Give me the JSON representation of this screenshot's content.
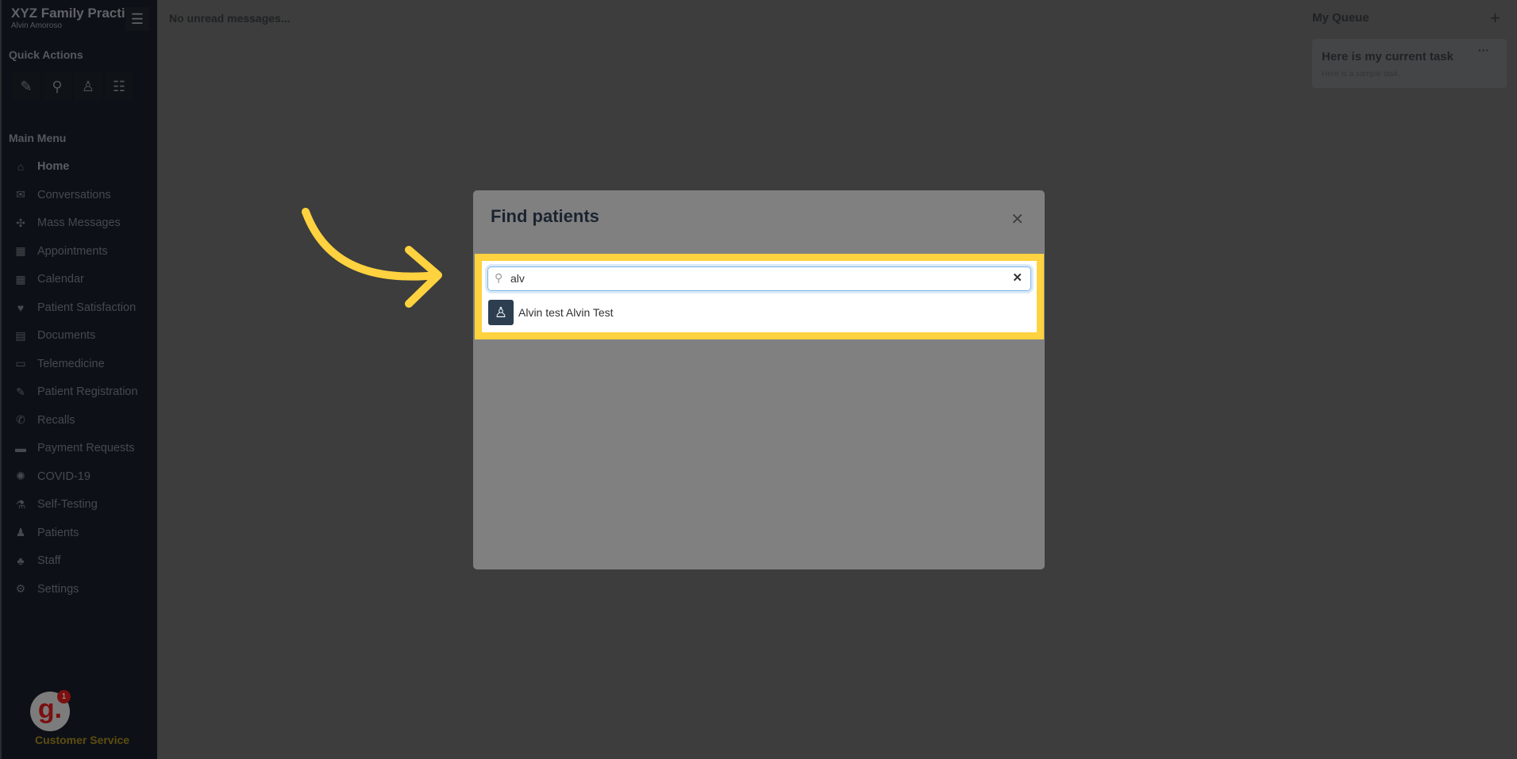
{
  "sidebar": {
    "practice": "XYZ Family Practice",
    "user": "Alvin Amoroso",
    "quick_actions_title": "Quick Actions",
    "main_menu_title": "Main Menu",
    "items": [
      {
        "label": "Home",
        "icon": "home-icon"
      },
      {
        "label": "Conversations",
        "icon": "chat-icon"
      },
      {
        "label": "Mass Messages",
        "icon": "broadcast-icon"
      },
      {
        "label": "Appointments",
        "icon": "calendar-clock-icon"
      },
      {
        "label": "Calendar",
        "icon": "calendar-icon"
      },
      {
        "label": "Patient Satisfaction",
        "icon": "heart-icon"
      },
      {
        "label": "Documents",
        "icon": "document-icon"
      },
      {
        "label": "Telemedicine",
        "icon": "monitor-icon"
      },
      {
        "label": "Patient Registration",
        "icon": "form-icon"
      },
      {
        "label": "Recalls",
        "icon": "phone-icon"
      },
      {
        "label": "Payment Requests",
        "icon": "credit-card-icon"
      },
      {
        "label": "COVID-19",
        "icon": "virus-icon"
      },
      {
        "label": "Self-Testing",
        "icon": "flask-icon"
      },
      {
        "label": "Patients",
        "icon": "patient-icon"
      },
      {
        "label": "Staff",
        "icon": "staff-icon"
      },
      {
        "label": "Settings",
        "icon": "gear-icon"
      }
    ],
    "customer_service": "Customer Service",
    "notification_count": "1"
  },
  "main": {
    "messages": "No unread messages..."
  },
  "queue": {
    "title": "My Queue",
    "task_title": "Here is my current task",
    "task_desc": "Here is a sample task."
  },
  "modal": {
    "title": "Find patients",
    "search_value": "alv",
    "results": [
      {
        "name": "Alvin test Alvin Test"
      }
    ]
  },
  "colors": {
    "highlight": "#ffd23f",
    "arrow": "#ffd23f",
    "avatar": "#2c3e50"
  }
}
